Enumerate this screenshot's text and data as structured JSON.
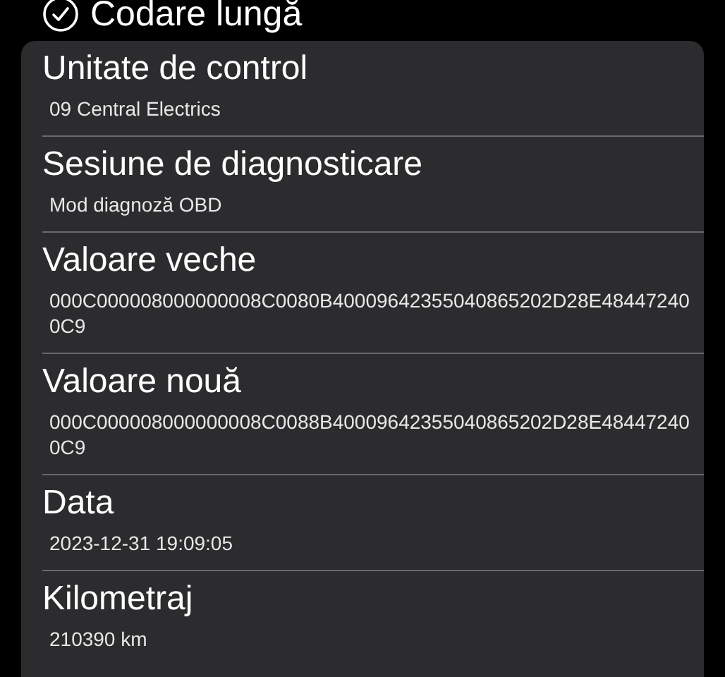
{
  "header": {
    "title": "Codare lungă"
  },
  "fields": [
    {
      "label": "Unitate de control",
      "value": "09 Central Electrics"
    },
    {
      "label": "Sesiune de diagnosticare",
      "value": "Mod diagnoză OBD"
    },
    {
      "label": "Valoare veche",
      "value": "000C000008000000008C0080B40009642355040865202D28E484472400C9"
    },
    {
      "label": "Valoare nouă",
      "value": "000C000008000000008C0088B40009642355040865202D28E484472400C9"
    },
    {
      "label": "Data",
      "value": "2023-12-31 19:09:05"
    },
    {
      "label": "Kilometraj",
      "value": "210390 km"
    }
  ]
}
